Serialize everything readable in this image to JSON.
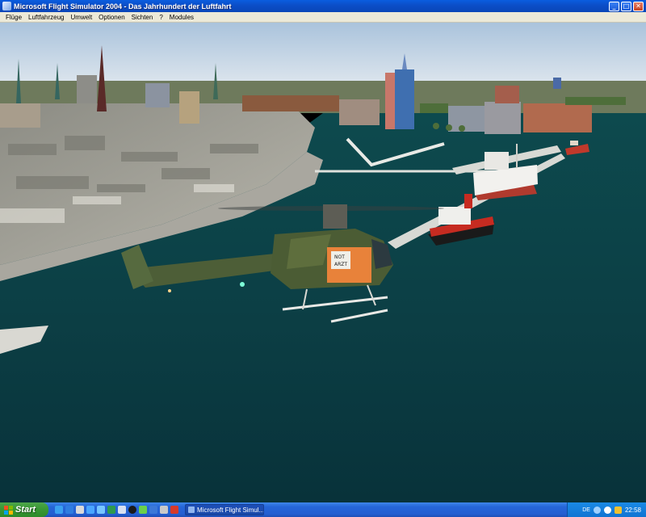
{
  "window": {
    "title": "Microsoft Flight Simulator 2004 - Das Jahrhundert der Luftfahrt",
    "buttons": [
      "minimize",
      "maximize",
      "close"
    ]
  },
  "menu": {
    "items": [
      "Flüge",
      "Luftfahrzeug",
      "Umwelt",
      "Optionen",
      "Sichten",
      "?",
      "Modules"
    ]
  },
  "scene": {
    "helicopter_markings": [
      "NOT",
      "ARZT"
    ]
  },
  "taskbar": {
    "start_label": "Start",
    "task_label": "Microsoft Flight Simul...",
    "language": "DE",
    "clock": "22:58"
  },
  "colors": {
    "titlebar": "#0b4fc9",
    "menubar": "#ece9d8",
    "taskbar": "#245ed1",
    "start_button": "#3a9a36",
    "water": "#0b3b3f",
    "sky": "#c8d9e8"
  }
}
